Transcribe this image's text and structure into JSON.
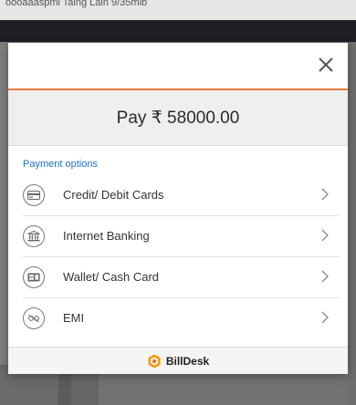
{
  "background": {
    "url_fragment": "oooaaaspmi  Taing Lain 9/35mlb"
  },
  "modal": {
    "close_icon": "close-icon",
    "amount_label": "Pay ₹ 58000.00",
    "options_heading": "Payment options",
    "options": [
      {
        "label": "Credit/ Debit Cards",
        "icon": "card-icon"
      },
      {
        "label": "Internet Banking",
        "icon": "bank-icon"
      },
      {
        "label": "Wallet/ Cash Card",
        "icon": "wallet-icon"
      },
      {
        "label": "EMI",
        "icon": "emi-icon"
      }
    ],
    "footer_brand": "BillDesk"
  },
  "colors": {
    "accent": "#f07b3f",
    "link_blue": "#1a73c7",
    "brand_orange": "#f39c12"
  }
}
